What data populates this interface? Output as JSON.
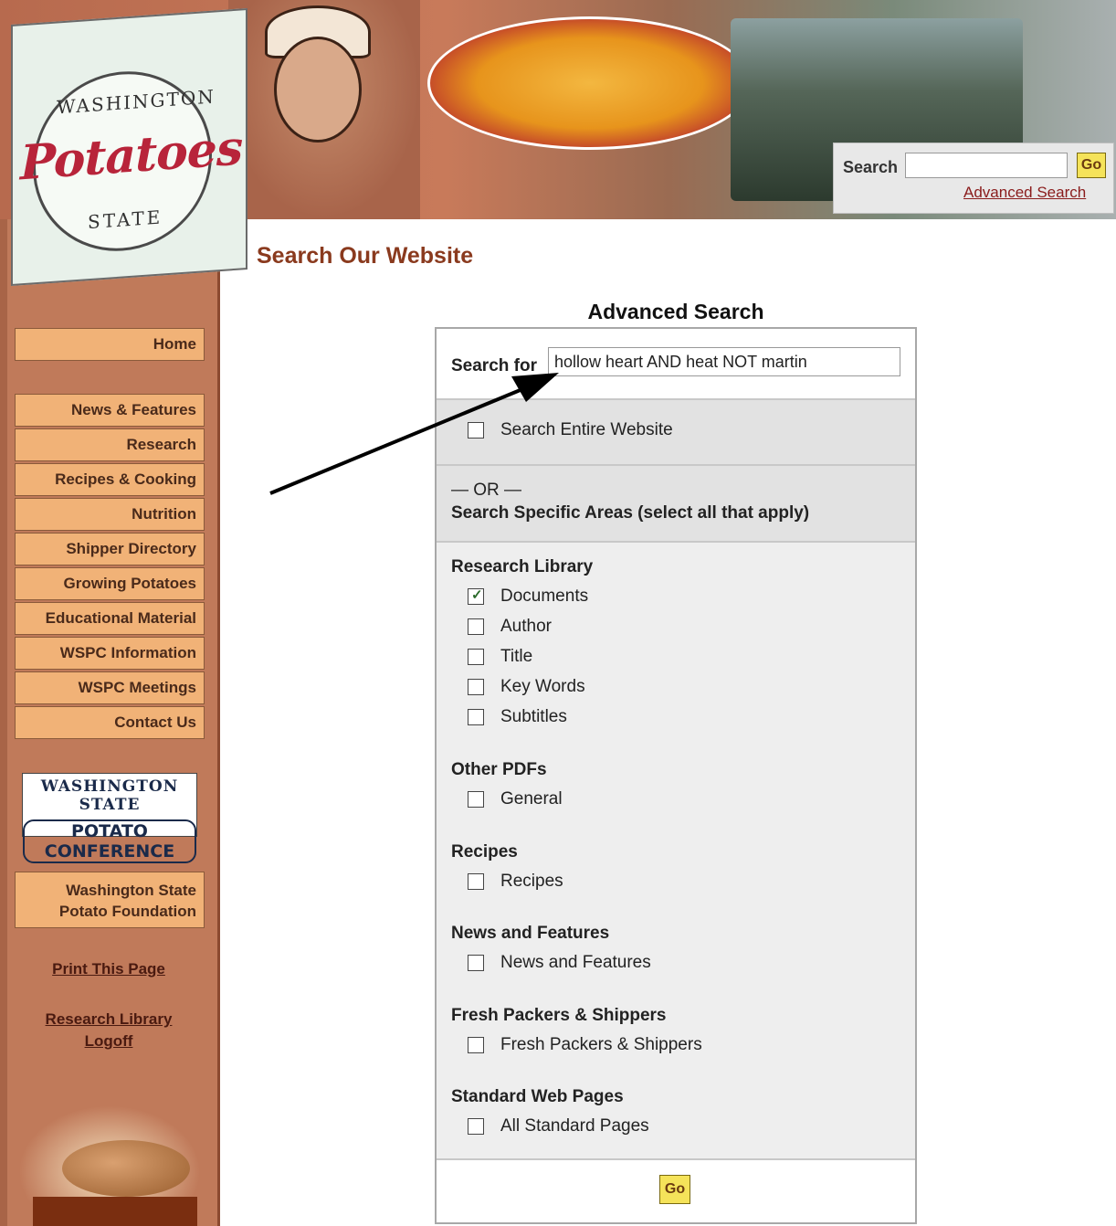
{
  "logo": {
    "word": "Potatoes",
    "top_text": "WASHINGTON",
    "bottom_text": "STATE"
  },
  "header": {
    "search_label": "Search",
    "search_value": "",
    "go_label": "Go",
    "advanced_link": "Advanced Search"
  },
  "sidebar": {
    "home": "Home",
    "items": [
      "News & Features",
      "Research",
      "Recipes & Cooking",
      "Nutrition",
      "Shipper Directory",
      "Growing Potatoes",
      "Educational Material",
      "WSPC Information",
      "WSPC Meetings",
      "Contact Us"
    ],
    "conference_top": "WASHINGTON STATE",
    "conference_bottom": "POTATO CONFERENCE",
    "foundation_line1": "Washington State",
    "foundation_line2": "Potato Foundation",
    "print_link": "Print This Page",
    "logoff_line1": "Research Library",
    "logoff_line2": "Logoff"
  },
  "main": {
    "page_title": "Search Our Website",
    "advanced_title": "Advanced Search",
    "search_for_label": "Search for",
    "search_for_value": "hollow heart AND heat NOT martin",
    "entire_label": "Search Entire Website",
    "or_text": "— OR —",
    "specific_label": "Search Specific Areas (select all that apply)",
    "groups": [
      {
        "title": "Research Library",
        "options": [
          {
            "label": "Documents",
            "checked": true
          },
          {
            "label": "Author",
            "checked": false
          },
          {
            "label": "Title",
            "checked": false
          },
          {
            "label": "Key Words",
            "checked": false
          },
          {
            "label": "Subtitles",
            "checked": false
          }
        ]
      },
      {
        "title": "Other PDFs",
        "options": [
          {
            "label": "General",
            "checked": false
          }
        ]
      },
      {
        "title": "Recipes",
        "options": [
          {
            "label": "Recipes",
            "checked": false
          }
        ]
      },
      {
        "title": "News and Features",
        "options": [
          {
            "label": "News and Features",
            "checked": false
          }
        ]
      },
      {
        "title": "Fresh Packers & Shippers",
        "options": [
          {
            "label": "Fresh Packers & Shippers",
            "checked": false
          }
        ]
      },
      {
        "title": "Standard Web Pages",
        "options": [
          {
            "label": "All Standard Pages",
            "checked": false
          }
        ]
      }
    ],
    "go_label": "Go"
  },
  "colors": {
    "sidebar": "#c07a5a",
    "nav_button": "#f1b277",
    "title": "#8a3a1e",
    "go_button": "#f5e35a"
  }
}
